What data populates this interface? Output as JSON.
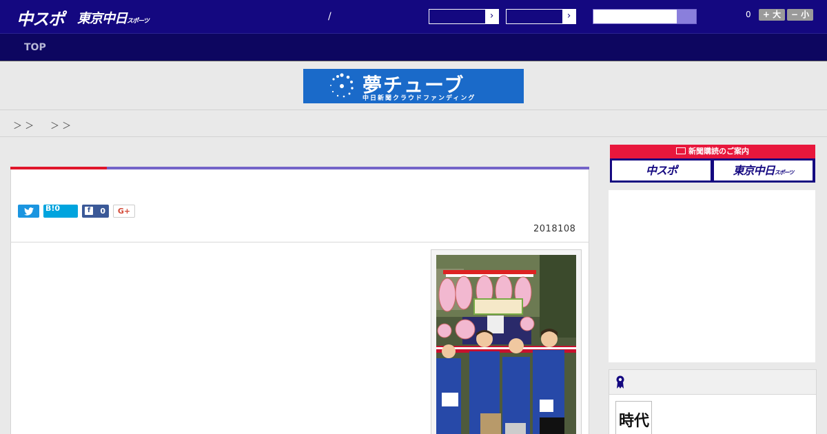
{
  "header": {
    "logo_main": "中スポ",
    "logo_tokyo": "東京中日",
    "logo_tokyo_small": "スポーツ",
    "separator": "/",
    "font_count": "0",
    "font_larger": "+ 大",
    "font_smaller": "− 小",
    "select_arrow": "›"
  },
  "nav": {
    "items": [
      {
        "label": "TOP"
      }
    ]
  },
  "banner": {
    "title": "夢チューブ",
    "subtitle": "中日新聞クラウドファンディング"
  },
  "breadcrumb": {
    "seps": [
      "＞ ＞",
      "＞ ＞"
    ]
  },
  "article": {
    "share": {
      "twitter_glyph": "t",
      "hatena": "B!0",
      "facebook_glyph": "f",
      "facebook_count": "0",
      "gplus": "G+"
    },
    "date": "2018108"
  },
  "sidebar": {
    "subscription": {
      "title": "新聞購読のご案内",
      "button_chunichi": "中スポ",
      "button_tokyo": "東京中日",
      "button_tokyo_small": "スポーツ"
    },
    "thumb_text": "時代"
  },
  "colors": {
    "header_bg": "#140880",
    "nav_bg": "#0d0660",
    "accent_red": "#e0162b",
    "accent_purple": "#7464c8",
    "banner_blue": "#1a6ac9"
  }
}
